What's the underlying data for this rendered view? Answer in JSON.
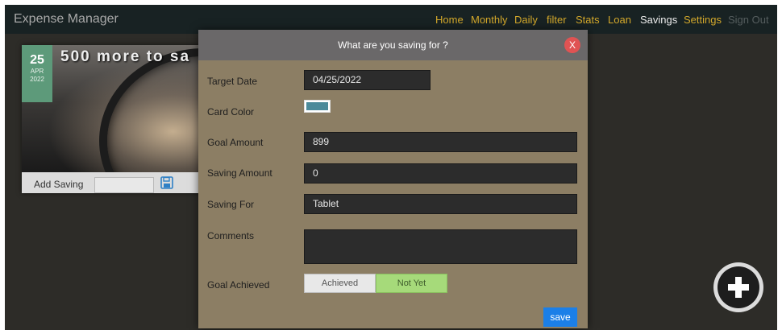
{
  "app": {
    "title": "Expense Manager"
  },
  "nav": {
    "items": [
      {
        "label": "Home"
      },
      {
        "label": "Monthly"
      },
      {
        "label": "Daily"
      },
      {
        "label": "filter"
      },
      {
        "label": "Stats"
      },
      {
        "label": "Loan"
      },
      {
        "label": "Savings"
      },
      {
        "label": "Settings"
      },
      {
        "label": "Sign Out"
      }
    ],
    "active": "Savings"
  },
  "card": {
    "day": "25",
    "month": "APR",
    "year": "2022",
    "title": "500 more to sa",
    "add_saving_label": "Add Saving",
    "add_saving_value": "",
    "save_icon": "floppy-disk-icon"
  },
  "modal": {
    "title": "What are you saving for ?",
    "close_label": "X",
    "fields": {
      "target_date": {
        "label": "Target Date",
        "value": "04/25/2022"
      },
      "card_color": {
        "label": "Card Color",
        "value": "#4b8a9a"
      },
      "goal_amount": {
        "label": "Goal Amount",
        "value": "899"
      },
      "saving_amount": {
        "label": "Saving Amount",
        "value": "0"
      },
      "saving_for": {
        "label": "Saving For",
        "value": "Tablet"
      },
      "comments": {
        "label": "Comments",
        "value": ""
      },
      "goal_achieved": {
        "label": "Goal Achieved",
        "options": [
          "Achieved",
          "Not Yet"
        ],
        "selected": "Not Yet"
      }
    },
    "save_label": "save"
  },
  "fab": {
    "icon": "plus-circle-icon"
  },
  "colors": {
    "accent": "#d3a82b",
    "modal_bg": "#8c7e64",
    "save_button": "#1b7fe8",
    "toggle_selected": "#a6da7a",
    "date_badge": "#5d9a7a"
  }
}
